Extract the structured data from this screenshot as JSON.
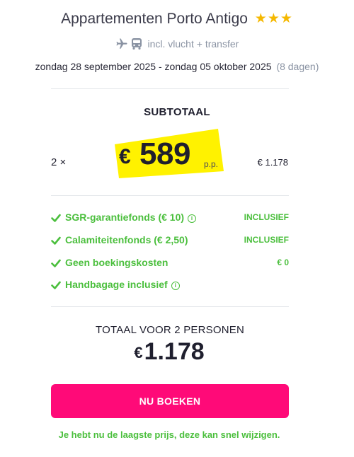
{
  "header": {
    "hotel_name": "Appartementen Porto Antigo",
    "star_rating": 3,
    "star_icons": [
      "star-icon",
      "star-icon",
      "star-icon"
    ],
    "includes_icons": [
      "airplane-icon",
      "bus-icon"
    ],
    "includes_text": "incl. vlucht + transfer",
    "dates": "zondag 28 september 2025 - zondag 05 oktober 2025",
    "nights": "(8 dagen)"
  },
  "subtotal": {
    "heading": "SUBTOTAAL",
    "quantity": "2 ×",
    "currency": "€",
    "price_per_person": "589",
    "per_person_label": "p.p.",
    "amount": "€ 1.178"
  },
  "features": [
    {
      "label": "SGR-garantiefonds  (€ 10)",
      "has_info": true,
      "value": "INCLUSIEF"
    },
    {
      "label": "Calamiteitenfonds  (€ 2,50)",
      "has_info": false,
      "value": "INCLUSIEF"
    },
    {
      "label": "Geen boekingskosten",
      "has_info": false,
      "value": "€ 0"
    },
    {
      "label": "Handbagage inclusief",
      "has_info": true,
      "value": ""
    }
  ],
  "total": {
    "heading": "TOTAAL VOOR 2 PERSONEN",
    "currency": "€",
    "amount": "1.178"
  },
  "cta": {
    "book_label": "NU BOEKEN",
    "lowest_price_note": "Je hebt nu de laagste prijs, deze kan snel wijzigen."
  },
  "colors": {
    "star": "#f5b800",
    "price_highlight": "#fff200",
    "feature_green": "#4bbf3d",
    "book_button": "#ff0a78",
    "muted_text": "#8a93a3"
  }
}
